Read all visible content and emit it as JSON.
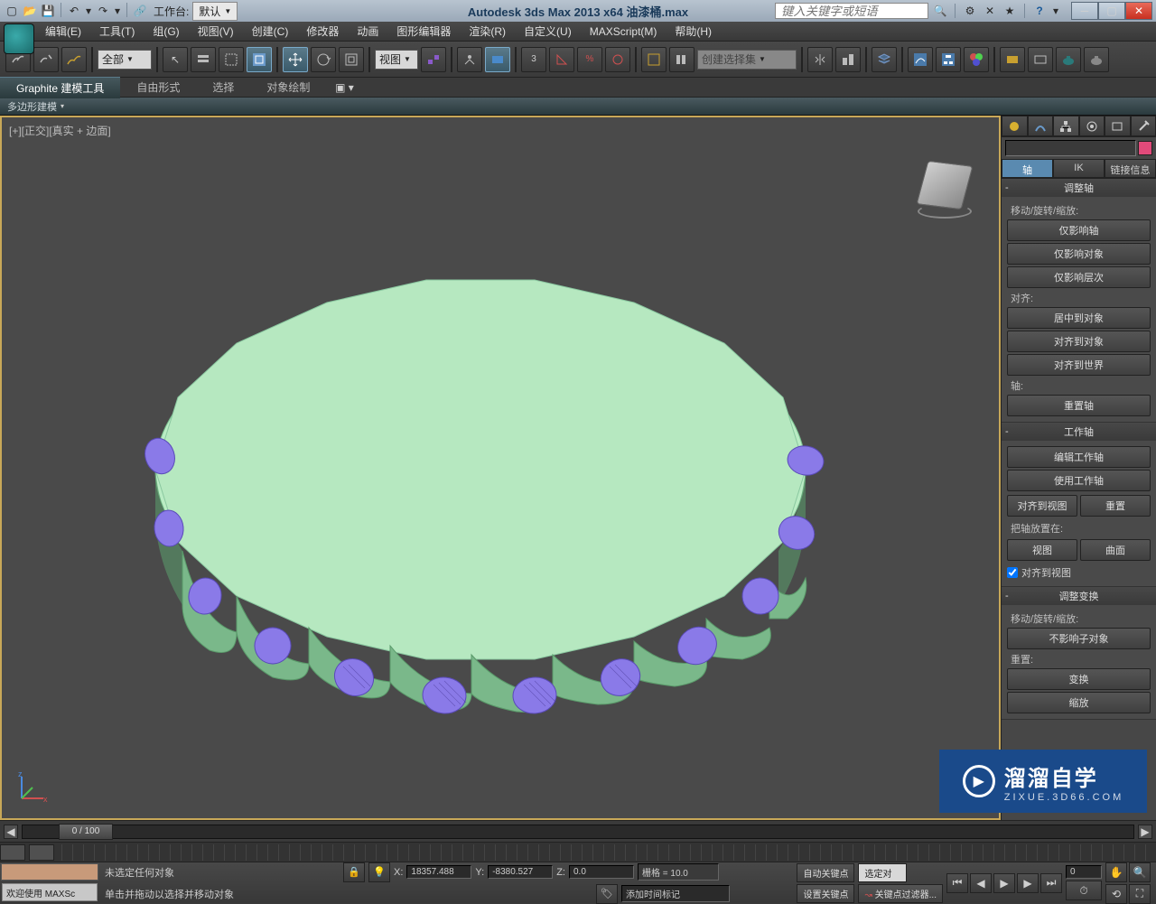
{
  "titlebar": {
    "workspace_label": "工作台:",
    "workspace_value": "默认",
    "app_title": "Autodesk 3ds Max  2013 x64     油漆桶.max",
    "search_placeholder": "键入关键字或短语"
  },
  "menu": {
    "items": [
      "编辑(E)",
      "工具(T)",
      "组(G)",
      "视图(V)",
      "创建(C)",
      "修改器",
      "动画",
      "图形编辑器",
      "渲染(R)",
      "自定义(U)",
      "MAXScript(M)",
      "帮助(H)"
    ]
  },
  "toolbar": {
    "filter_all": "全部",
    "view_dd": "视图",
    "selset_dd": "创建选择集"
  },
  "ribbon": {
    "tabs": [
      "Graphite 建模工具",
      "自由形式",
      "选择",
      "对象绘制"
    ],
    "subtab": "多边形建模"
  },
  "viewport": {
    "label": "[+][正交][真实 + 边面]"
  },
  "panel": {
    "subtabs": [
      "轴",
      "IK",
      "链接信息"
    ],
    "rollouts": {
      "adjust_pivot": {
        "title": "调整轴",
        "move_label": "移动/旋转/缩放:",
        "affect_pivot": "仅影响轴",
        "affect_object": "仅影响对象",
        "affect_hier": "仅影响层次",
        "align_label": "对齐:",
        "center_to": "居中到对象",
        "align_to": "对齐到对象",
        "align_world": "对齐到世界",
        "pivot_label": "轴:",
        "reset_pivot": "重置轴"
      },
      "working_pivot": {
        "title": "工作轴",
        "edit_wp": "编辑工作轴",
        "use_wp": "使用工作轴",
        "align_view": "对齐到视图",
        "reset": "重置",
        "place_label": "把轴放置在:",
        "view_btn": "视图",
        "surface_btn": "曲面",
        "align_view_chk": "对齐到视图"
      },
      "adjust_xform": {
        "title": "调整变换",
        "move_label": "移动/旋转/缩放:",
        "no_affect_children": "不影响子对象",
        "reset_label": "重置:",
        "transform": "变换",
        "scale": "缩放"
      }
    }
  },
  "timeline": {
    "current": "0 / 100"
  },
  "status": {
    "welcome": "欢迎使用 MAXSc",
    "line1": "未选定任何对象",
    "line2": "单击并拖动以选择并移动对象",
    "x_label": "X:",
    "x_val": "18357.488",
    "y_label": "Y:",
    "y_val": "-8380.527",
    "z_label": "Z:",
    "z_val": "0.0",
    "grid": "栅格 = 10.0",
    "autokey": "自动关键点",
    "setkey": "设置关键点",
    "sel_set": "选定对",
    "keyfilter": "关键点过滤器...",
    "add_tag": "添加时间标记",
    "frame_val": "0"
  },
  "watermark": {
    "main": "溜溜自学",
    "sub": "ZIXUE.3D66.COM"
  }
}
